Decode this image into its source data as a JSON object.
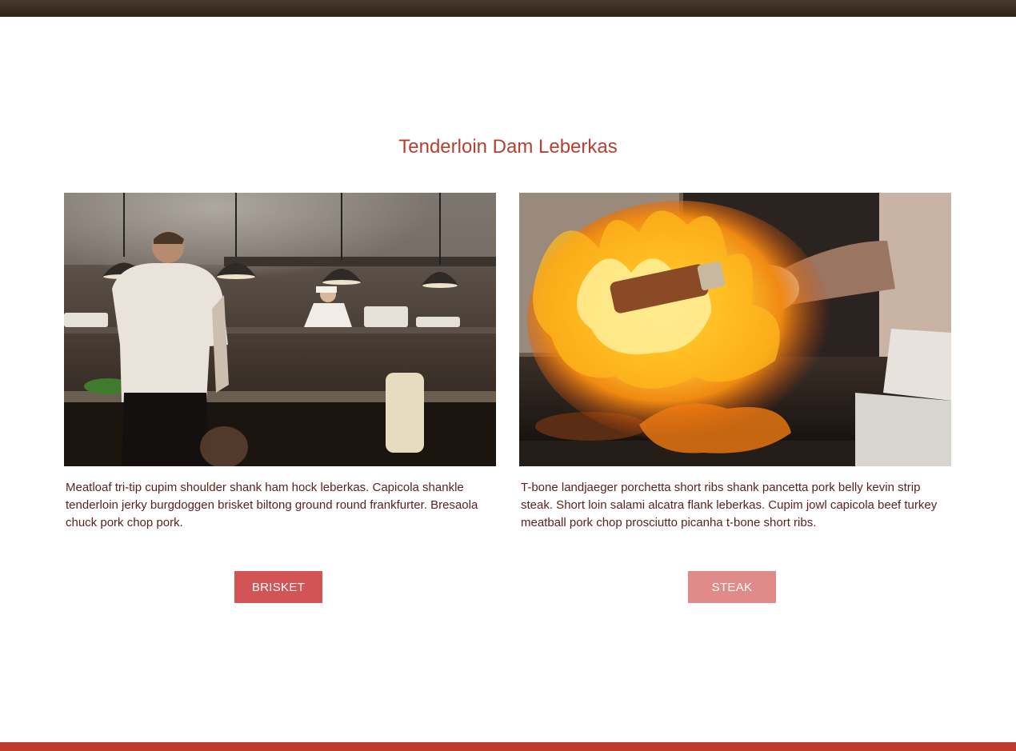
{
  "section": {
    "title": "Tenderloin Dam Leberkas"
  },
  "cards": [
    {
      "image_subject": "restaurant kitchen with chefs",
      "description": "Meatloaf tri-tip cupim shoulder shank ham hock leberkas. Capicola shankle tenderloin jerky burgdoggen brisket biltong ground round frankfurter. Bre­saola chuck pork chop pork.",
      "button_label": "BRISKET",
      "button_color": "#d35454"
    },
    {
      "image_subject": "flambé flames on a grill",
      "description": "T-bone landjaeger porchetta short ribs shank pancetta pork belly kevin strip steak. Short loin salami alcatra flank leberkas. Cupim jowl capicola beef turkey meatball pork chop prosciutto picanha t-bone short ribs.",
      "button_label": "STEAK",
      "button_color": "#e08a8a"
    }
  ],
  "colors": {
    "accent": "#c0392b",
    "title": "#b5402f",
    "text": "#5a1f1f",
    "header_bar": "#3a2c20"
  }
}
